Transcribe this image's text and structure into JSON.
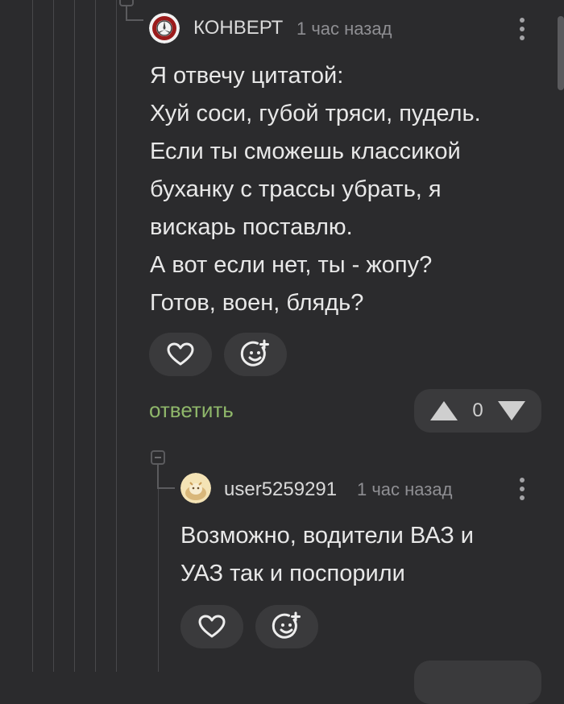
{
  "comment_main": {
    "author": "КОНВЕРТ",
    "time": "1 час назад",
    "lines": [
      "Я отвечу цитатой:",
      "Хуй соси, губой тряси, пудель.",
      "Если ты сможешь классикой",
      "буханку с трассы убрать, я",
      "вискарь поставлю.",
      "А вот если нет, ты - жопу?",
      "Готов, воен, блядь?"
    ],
    "reply_label": "ответить",
    "vote_count": "0",
    "avatar_icon": "mercedes-logo-icon"
  },
  "comment_reply": {
    "author": "user5259291",
    "time": "1 час назад",
    "lines": [
      "Возможно, водители ВАЗ и",
      "УАЗ так и поспорили"
    ],
    "avatar_icon": "user-avatar-icon"
  },
  "icons": {
    "like": "heart-icon",
    "react": "emoji-add-icon",
    "upvote": "triangle-up-icon",
    "downvote": "triangle-down-icon",
    "menu": "kebab-menu-icon"
  },
  "colors": {
    "background": "#2b2b2d",
    "button": "#3a3a3c",
    "reply_link": "#8fb76a",
    "muted": "#8f8f93"
  }
}
